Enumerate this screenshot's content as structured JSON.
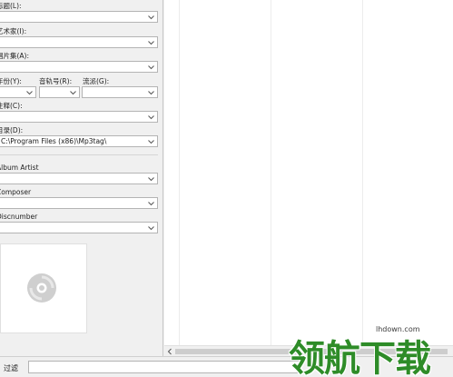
{
  "tag_panel": {
    "title_label": "标题(L):",
    "artist_label": "艺术家(I):",
    "album_label": "唱片集(A):",
    "year_label": "年份(Y):",
    "track_label": "音轨号(R):",
    "genre_label": "流派(G):",
    "comment_label": "注释(C):",
    "directory_label": "目录(D):",
    "directory_value": "C:\\Program Files (x86)\\Mp3tag\\",
    "album_artist_label": "Album Artist",
    "composer_label": "Composer",
    "discnumber_label": "Discnumber"
  },
  "cover_icon": "cd-disc-icon",
  "statusbar": {
    "filter_label": "过滤",
    "filter_value": ""
  },
  "watermark": {
    "text": "领航下载",
    "url": "lhdown.com",
    "color": "#2e8c28"
  }
}
